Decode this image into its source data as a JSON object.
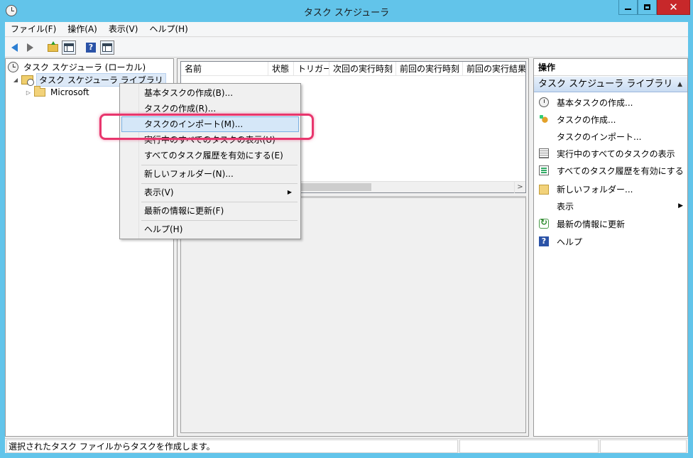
{
  "window": {
    "title": "タスク スケジューラ",
    "close_glyph": "✕"
  },
  "menubar": [
    {
      "label": "ファイル(F)"
    },
    {
      "label": "操作(A)"
    },
    {
      "label": "表示(V)"
    },
    {
      "label": "ヘルプ(H)"
    }
  ],
  "toolbar": {
    "help_glyph": "?"
  },
  "tree": {
    "root": "タスク スケジューラ (ローカル)",
    "library": "タスク スケジューラ ライブラリ",
    "microsoft": "Microsoft",
    "expanded_glyph": "◢",
    "collapsed_glyph": "▷"
  },
  "task_list": {
    "columns": [
      "名前",
      "状態",
      "トリガー",
      "次回の実行時刻",
      "前回の実行時刻",
      "前回の実行結果"
    ],
    "scroll_right_glyph": ">"
  },
  "actions": {
    "header": "操作",
    "group_title": "タスク スケジューラ ライブラリ",
    "group_collapse_glyph": "▲",
    "submenu_glyph": "▶",
    "help_glyph": "?",
    "items": [
      {
        "label": "基本タスクの作成...",
        "icon": "clock-icon"
      },
      {
        "label": "タスクの作成...",
        "icon": "task-icon"
      },
      {
        "label": "タスクのインポート...",
        "icon": ""
      },
      {
        "label": "実行中のすべてのタスクの表示",
        "icon": "list-icon"
      },
      {
        "label": "すべてのタスク履歴を有効にする",
        "icon": "history-icon"
      },
      {
        "label": "新しいフォルダー...",
        "icon": "folder-icon"
      },
      {
        "label": "表示",
        "icon": ""
      },
      {
        "label": "最新の情報に更新",
        "icon": "refresh-icon"
      },
      {
        "label": "ヘルプ",
        "icon": "help-icon"
      }
    ]
  },
  "context_menu": {
    "submenu_glyph": "▶",
    "items": [
      {
        "label": "基本タスクの作成(B)..."
      },
      {
        "label": "タスクの作成(R)..."
      },
      {
        "label": "タスクのインポート(M)..."
      },
      {
        "label": "実行中のすべてのタスクの表示(U)"
      },
      {
        "label": "すべてのタスク履歴を有効にする(E)"
      },
      {
        "label": "新しいフォルダー(N)..."
      },
      {
        "label": "表示(V)"
      },
      {
        "label": "最新の情報に更新(F)"
      },
      {
        "label": "ヘルプ(H)"
      }
    ]
  },
  "statusbar": {
    "text": "選択されたタスク ファイルからタスクを作成します。"
  },
  "colors": {
    "title_bar": "#62c4ea",
    "close_button": "#c7282a",
    "highlight": "#d5e7f8",
    "callout": "#e8366d"
  }
}
